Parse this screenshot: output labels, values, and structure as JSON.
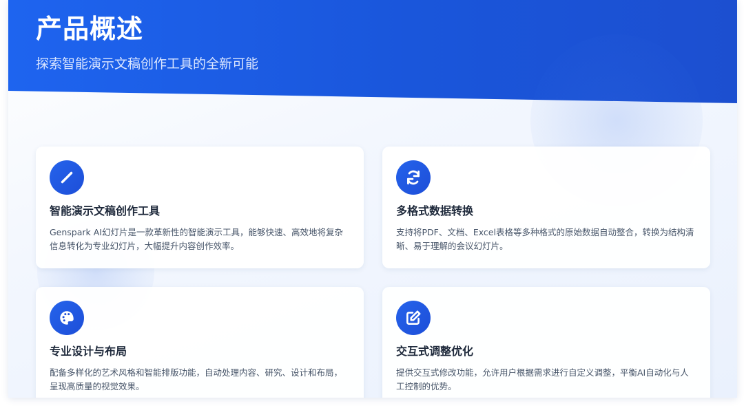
{
  "header": {
    "title": "产品概述",
    "subtitle": "探索智能演示文稿创作工具的全新可能"
  },
  "cards": [
    {
      "icon": "pencil-icon",
      "title": "智能演示文稿创作工具",
      "description": "Genspark AI幻灯片是一款革新性的智能演示工具，能够快速、高效地将复杂信息转化为专业幻灯片，大幅提升内容创作效率。"
    },
    {
      "icon": "sync-icon",
      "title": "多格式数据转换",
      "description": "支持将PDF、文档、Excel表格等多种格式的原始数据自动整合，转换为结构清晰、易于理解的会议幻灯片。"
    },
    {
      "icon": "palette-icon",
      "title": "专业设计与布局",
      "description": "配备多样化的艺术风格和智能排版功能，自动处理内容、研究、设计和布局，呈现高质量的视觉效果。"
    },
    {
      "icon": "edit-icon",
      "title": "交互式调整优化",
      "description": "提供交互式修改功能，允许用户根据需求进行自定义调整，平衡AI自动化与人工控制的优势。"
    }
  ],
  "colors": {
    "accent": "#1a56db",
    "card_title": "#1e293b",
    "card_text": "#475569"
  }
}
